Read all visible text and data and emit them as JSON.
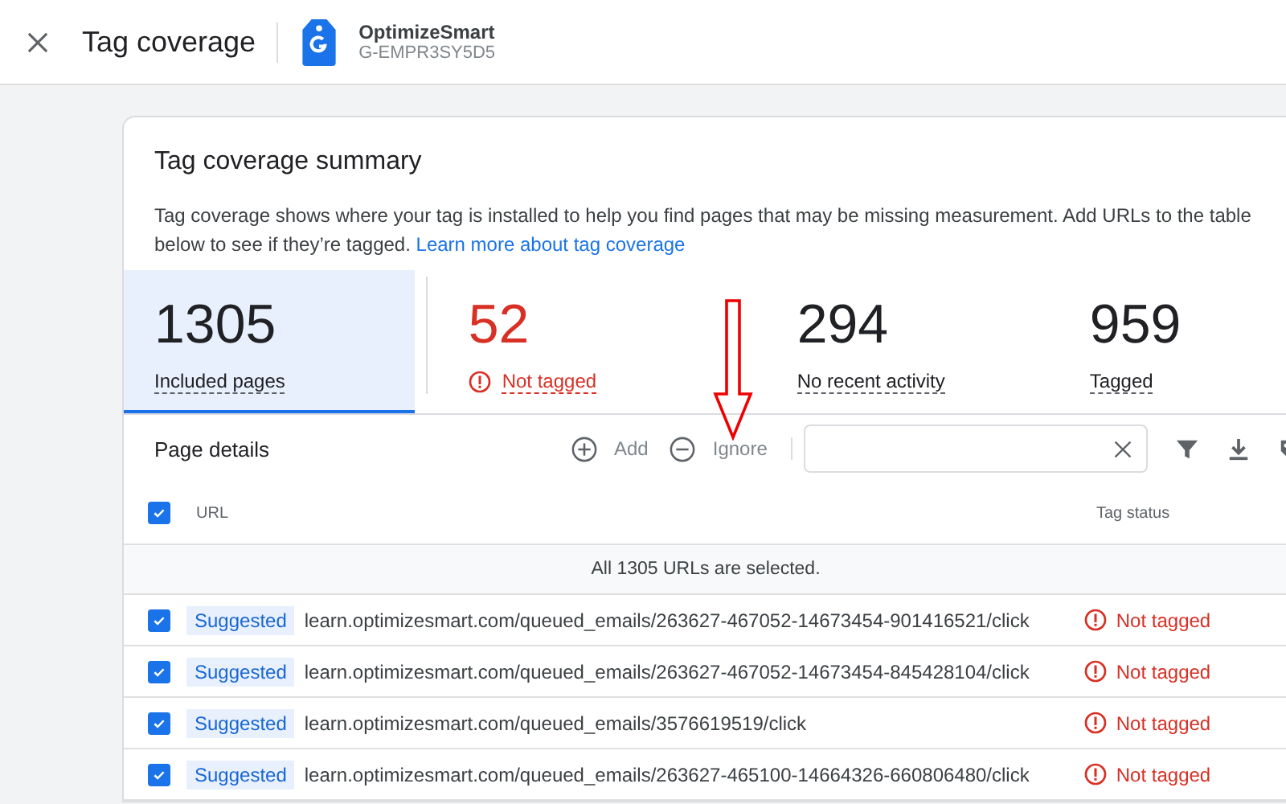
{
  "header": {
    "title": "Tag coverage",
    "account_name": "OptimizeSmart",
    "account_id": "G-EMPR3SY5D5"
  },
  "summary": {
    "title": "Tag coverage summary",
    "description": "Tag coverage shows where your tag is installed to help you find pages that may be missing measurement. Add URLs to the table below to see if they’re tagged.",
    "link": "Learn more about tag coverage"
  },
  "stats": [
    {
      "value": "1305",
      "label": "Included pages",
      "kind": "plain",
      "selected": true
    },
    {
      "value": "52",
      "label": "Not tagged",
      "kind": "warning",
      "selected": false
    },
    {
      "value": "294",
      "label": "No recent activity",
      "kind": "plain",
      "selected": false
    },
    {
      "value": "959",
      "label": "Tagged",
      "kind": "plain",
      "selected": false
    }
  ],
  "page_details": {
    "title": "Page details",
    "actions": [
      {
        "label": "Add",
        "kind": "add"
      },
      {
        "label": "Ignore",
        "kind": "remove"
      }
    ],
    "columns": [
      "URL",
      "Tag status"
    ],
    "select_all_checked": true,
    "banner": "All 1305 URLs are selected.",
    "rows": [
      {
        "checked": true,
        "badge": "Suggested",
        "url": "learn.optimizesmart.com/queued_emails/263627-467052-14673454-901416521/click",
        "status": "Not tagged",
        "kind": "warning"
      },
      {
        "checked": true,
        "badge": "Suggested",
        "url": "learn.optimizesmart.com/queued_emails/263627-467052-14673454-845428104/click",
        "status": "Not tagged",
        "kind": "warning"
      },
      {
        "checked": true,
        "badge": "Suggested",
        "url": "learn.optimizesmart.com/queued_emails/3576619519/click",
        "status": "Not tagged",
        "kind": "warning"
      },
      {
        "checked": true,
        "badge": "Suggested",
        "url": "learn.optimizesmart.com/queued_emails/263627-465100-14664326-660806480/click",
        "status": "Not tagged",
        "kind": "warning"
      }
    ]
  }
}
